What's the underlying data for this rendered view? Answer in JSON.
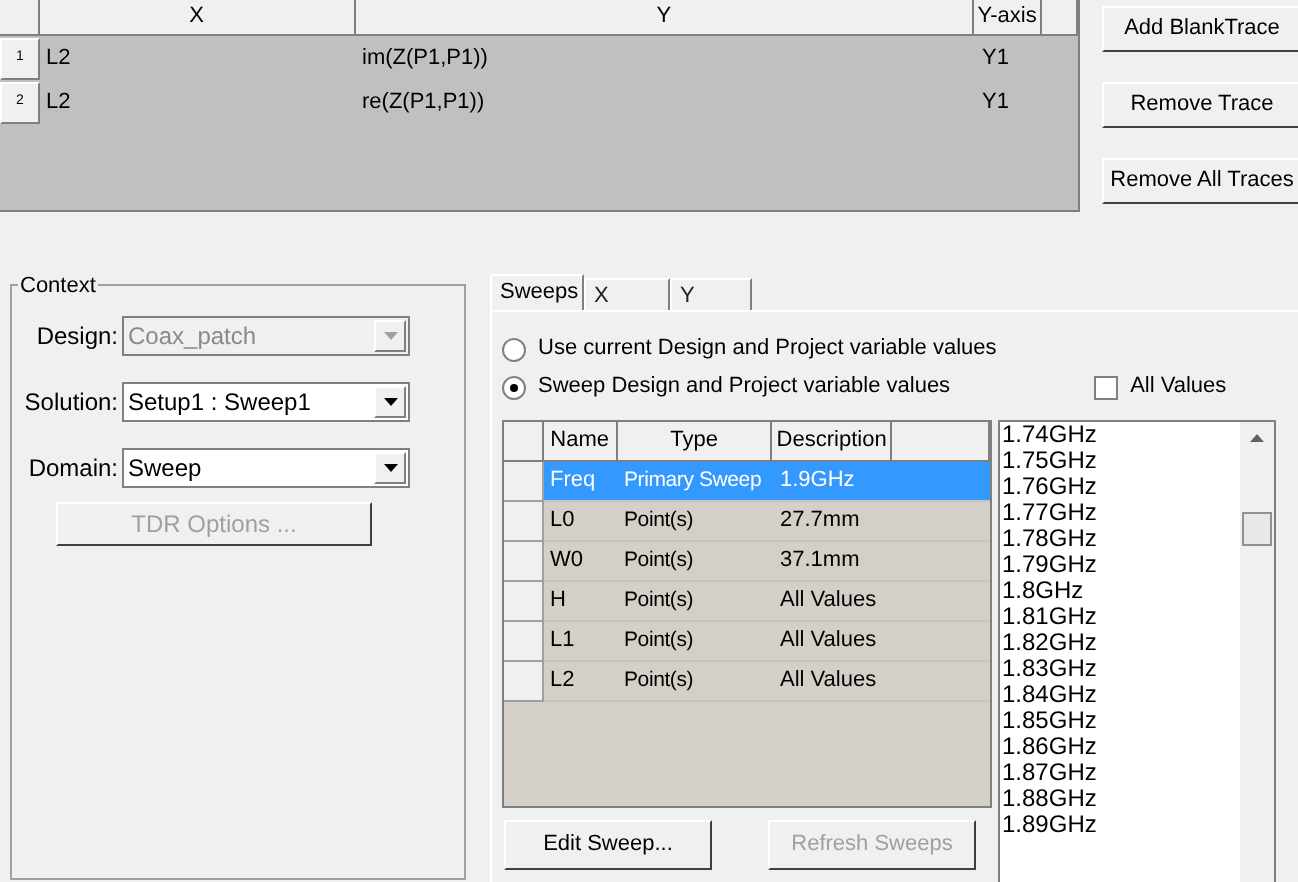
{
  "traces": {
    "columns": [
      "X",
      "Y",
      "Y-axis"
    ],
    "rows": [
      {
        "number": "1",
        "x": "L2",
        "y": "im(Z(P1,P1))",
        "axis": "Y1"
      },
      {
        "number": "2",
        "x": "L2",
        "y": "re(Z(P1,P1))",
        "axis": "Y1"
      }
    ]
  },
  "trace_buttons": [
    {
      "label": "Add BlankTrace"
    },
    {
      "label": "Remove Trace"
    },
    {
      "label": "Remove All Traces"
    }
  ],
  "context": {
    "title": "Context",
    "fields": [
      {
        "label": "Design:",
        "value": "Coax_patch",
        "disabled": true
      },
      {
        "label": "Solution:",
        "value": "Setup1 : Sweep1",
        "disabled": false
      },
      {
        "label": "Domain:",
        "value": "Sweep",
        "disabled": false
      }
    ],
    "tdr_button": {
      "label": "TDR Options ...",
      "disabled": true
    }
  },
  "tabs": [
    {
      "label": "Sweeps",
      "selected": true
    },
    {
      "label": "X",
      "selected": false
    },
    {
      "label": "Y",
      "selected": false
    }
  ],
  "radios": [
    {
      "label": "Use current Design and Project variable values",
      "selected": false
    },
    {
      "label": "Sweep Design and Project variable values",
      "selected": true
    }
  ],
  "all_values": {
    "label": "All Values",
    "checked": false
  },
  "sweeps": {
    "columns": [
      "Name",
      "Type",
      "Description"
    ],
    "rows": [
      {
        "name": "Freq",
        "type": "Primary Sweep",
        "description": "1.9GHz",
        "selected": true
      },
      {
        "name": "L0",
        "type": "Point(s)",
        "description": "27.7mm",
        "selected": false
      },
      {
        "name": "W0",
        "type": "Point(s)",
        "description": "37.1mm",
        "selected": false
      },
      {
        "name": "H",
        "type": "Point(s)",
        "description": "All Values",
        "selected": false
      },
      {
        "name": "L1",
        "type": "Point(s)",
        "description": "All Values",
        "selected": false
      },
      {
        "name": "L2",
        "type": "Point(s)",
        "description": "All Values",
        "selected": false
      }
    ]
  },
  "values": [
    "1.74GHz",
    "1.75GHz",
    "1.76GHz",
    "1.77GHz",
    "1.78GHz",
    "1.79GHz",
    "1.8GHz",
    "1.81GHz",
    "1.82GHz",
    "1.83GHz",
    "1.84GHz",
    "1.85GHz",
    "1.86GHz",
    "1.87GHz",
    "1.88GHz",
    "1.89GHz"
  ],
  "sweep_buttons": [
    {
      "label": "Edit Sweep...",
      "disabled": false
    },
    {
      "label": "Refresh Sweeps",
      "disabled": true
    }
  ]
}
